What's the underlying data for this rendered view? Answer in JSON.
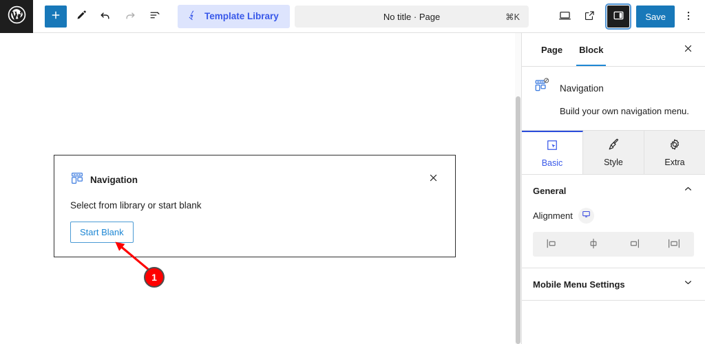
{
  "topbar": {
    "logo_icon": "wordpress-logo-icon",
    "tools": [
      {
        "name": "add-block-button",
        "icon": "plus-icon",
        "label": "Add block",
        "state": "primary"
      },
      {
        "name": "edit-tool-button",
        "icon": "pencil-icon",
        "label": "Tools",
        "state": "default"
      },
      {
        "name": "undo-button",
        "icon": "undo-arrow-icon",
        "label": "Undo",
        "state": "default"
      },
      {
        "name": "redo-button",
        "icon": "redo-arrow-icon",
        "label": "Redo",
        "state": "disabled"
      },
      {
        "name": "list-view-button",
        "icon": "list-view-icon",
        "label": "List View",
        "state": "default"
      }
    ],
    "template_library_label": "Template Library",
    "template_library_icon": "template-library-logo-icon",
    "command_bar": {
      "title": "No title · Page",
      "shortcut": "⌘K"
    },
    "right_tools": [
      {
        "name": "view-device-button",
        "icon": "desktop-icon",
        "label": "View"
      },
      {
        "name": "preview-external-button",
        "icon": "external-link-icon",
        "label": "Preview"
      }
    ],
    "sidebar_toggle_icon": "settings-sidebar-icon",
    "save_label": "Save",
    "options_icon": "more-vertical-icon",
    "accent_blue": "#1878b9",
    "brand_blue": "#3858e9"
  },
  "canvas": {
    "nav_block": {
      "icon": "navigation-block-icon",
      "title": "Navigation",
      "description": "Select from library or start blank",
      "start_blank_label": "Start Blank",
      "close_icon": "close-icon"
    }
  },
  "annotation": {
    "step_number": "1",
    "badge_color": "#fe0000",
    "arrow_color": "#fe0000"
  },
  "sidebar": {
    "tabs": [
      {
        "label": "Page",
        "active": false
      },
      {
        "label": "Block",
        "active": true
      }
    ],
    "close_icon": "close-icon",
    "block": {
      "icon": "navigation-block-icon",
      "title": "Navigation",
      "description": "Build your own navigation menu."
    },
    "subtabs": [
      {
        "label": "Basic",
        "icon": "cursor-select-icon",
        "active": true
      },
      {
        "label": "Style",
        "icon": "paintbrush-icon",
        "active": false
      },
      {
        "label": "Extra",
        "icon": "gear-icon",
        "active": false
      }
    ],
    "sections": [
      {
        "title": "General",
        "expanded": true,
        "chevron": "chevron-up-icon"
      },
      {
        "title": "Mobile Menu Settings",
        "expanded": false,
        "chevron": "chevron-down-icon"
      }
    ],
    "alignment": {
      "label": "Alignment",
      "device_icon": "desktop-responsive-icon",
      "options": [
        {
          "name": "align-left",
          "icon": "align-left-icon"
        },
        {
          "name": "align-center",
          "icon": "align-center-icon"
        },
        {
          "name": "align-right",
          "icon": "align-right-icon"
        },
        {
          "name": "align-full",
          "icon": "align-full-icon"
        }
      ]
    }
  }
}
